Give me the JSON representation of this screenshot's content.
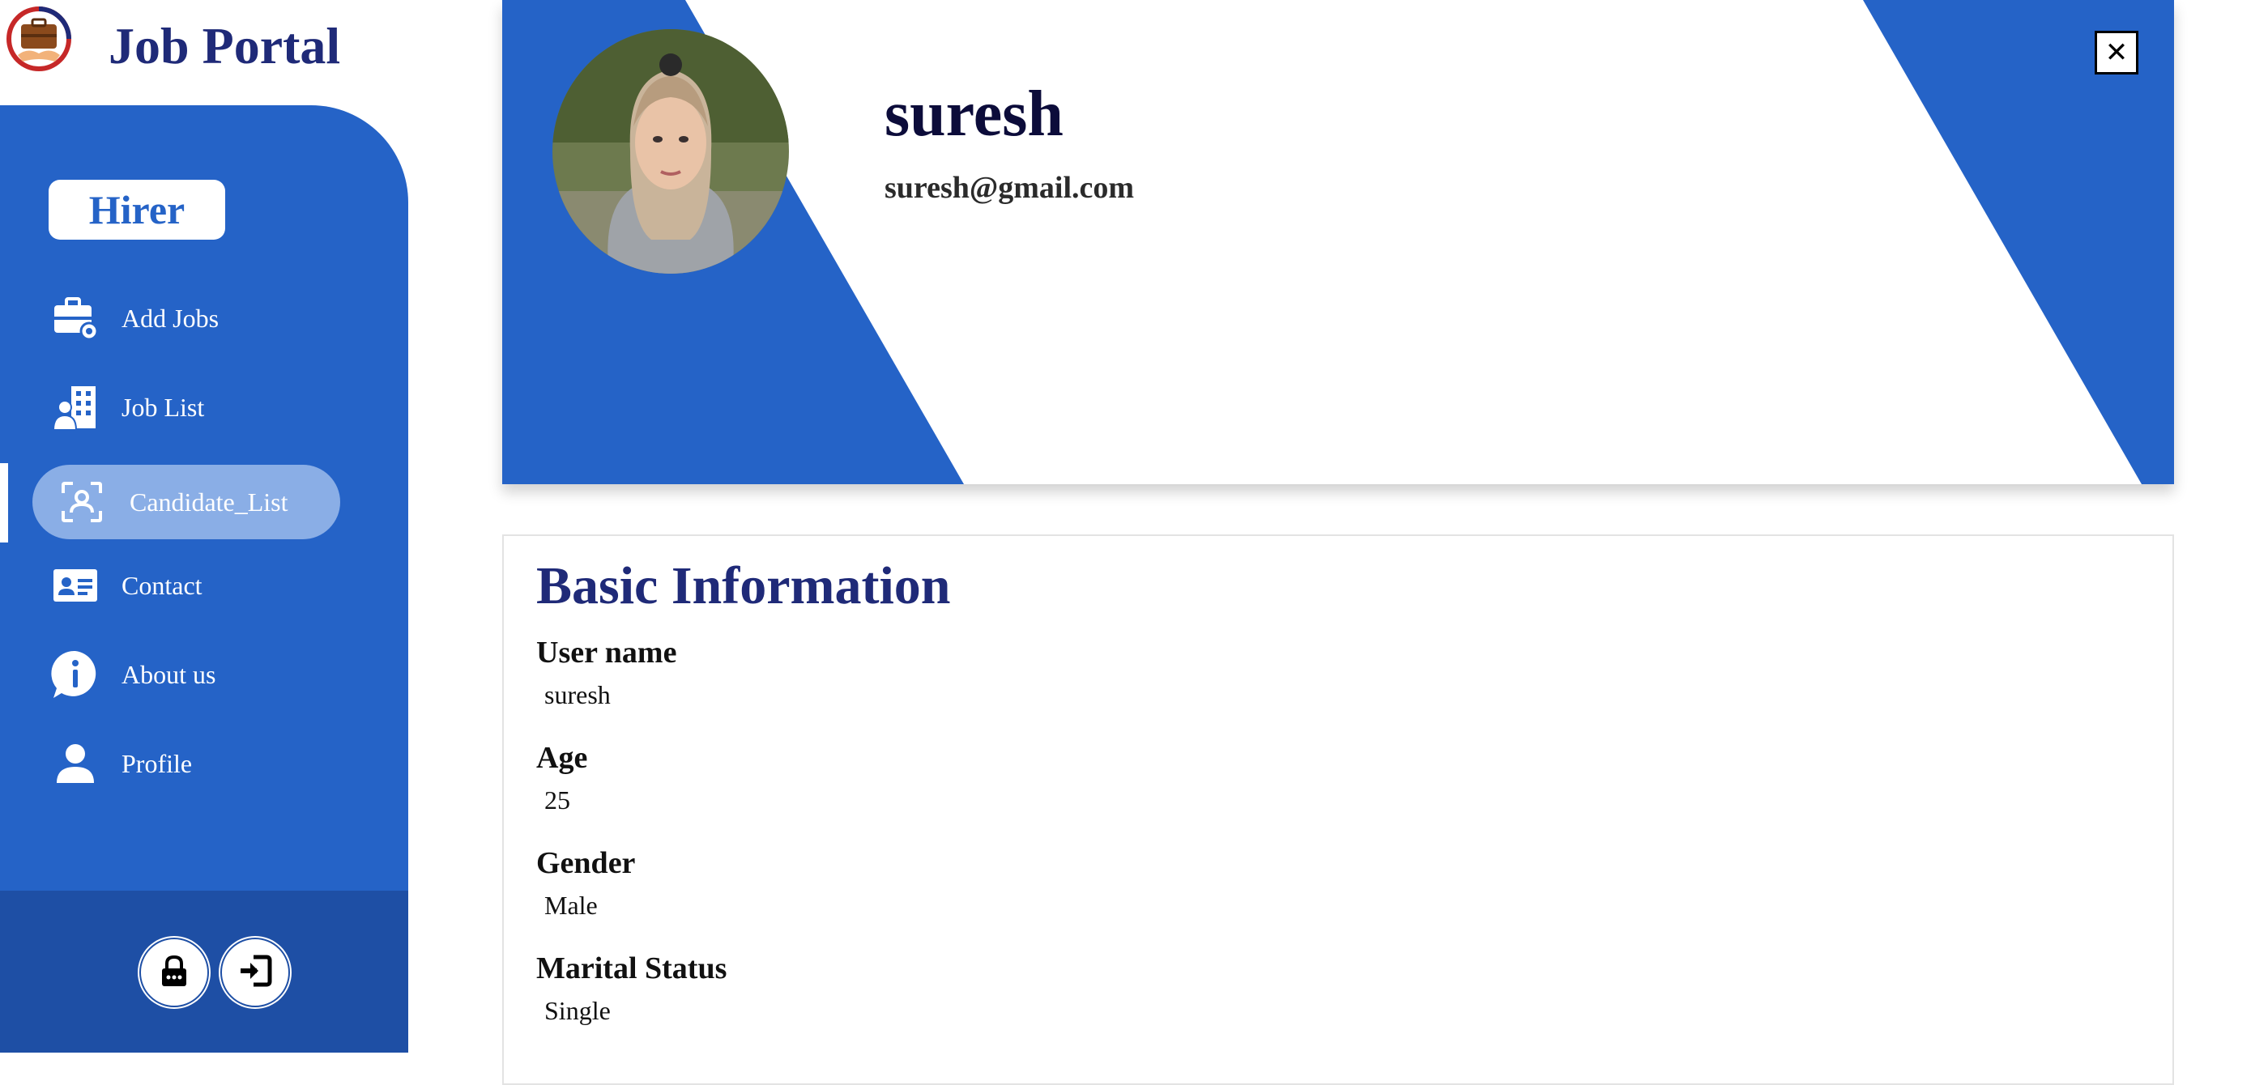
{
  "app": {
    "title": "Job Portal"
  },
  "sidebar": {
    "role": "Hirer",
    "items": [
      {
        "label": "Add Jobs",
        "icon": "briefcase-gear-icon"
      },
      {
        "label": "Job List",
        "icon": "building-person-icon"
      },
      {
        "label": "Candidate_List",
        "icon": "user-scan-icon",
        "active": true
      },
      {
        "label": "Contact",
        "icon": "contact-card-icon"
      },
      {
        "label": "About us",
        "icon": "info-bubble-icon"
      },
      {
        "label": "Profile",
        "icon": "user-icon"
      }
    ],
    "bottom_buttons": [
      {
        "icon": "lock-icon"
      },
      {
        "icon": "logout-icon"
      }
    ]
  },
  "profile": {
    "name": "suresh",
    "email": "suresh@gmail.com",
    "close_label": "✕"
  },
  "basic_info": {
    "title": "Basic Information",
    "fields": [
      {
        "label": "User name",
        "value": "suresh"
      },
      {
        "label": "Age",
        "value": "25"
      },
      {
        "label": "Gender",
        "value": "Male"
      },
      {
        "label": "Marital Status",
        "value": "Single"
      }
    ]
  },
  "colors": {
    "primary": "#2563c7",
    "sidebar_bottom": "#1e4fa5",
    "active_item": "#8aaee6",
    "title_navy": "#1f2a78"
  }
}
